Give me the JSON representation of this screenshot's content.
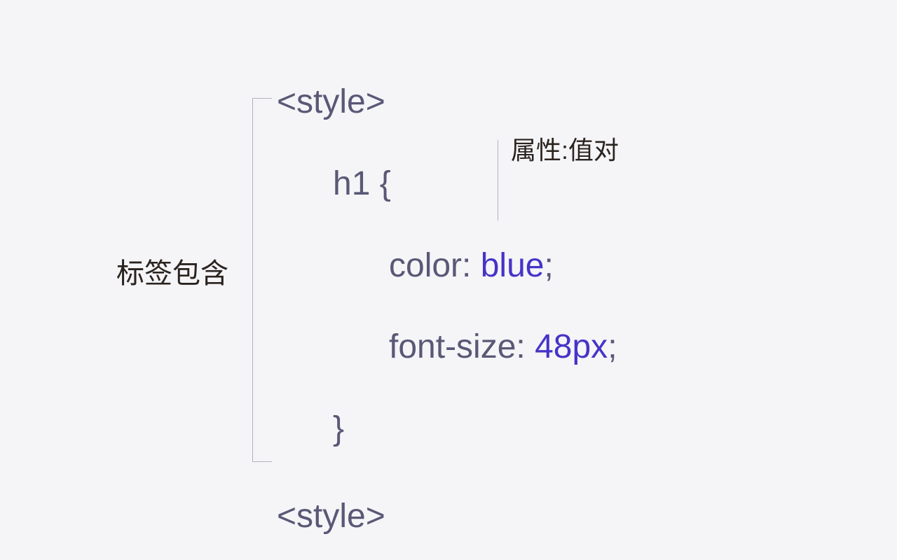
{
  "labels": {
    "tag_contains": "标签包含",
    "property_value_pair": "属性:值对"
  },
  "code": {
    "open_tag": "<style>",
    "selector": "h1 {",
    "decl1_prop": "color:",
    "decl1_value": "blue",
    "decl1_semicolon": ";",
    "decl2_prop": "font-size:",
    "decl2_value": "48px",
    "decl2_semicolon": ";",
    "close_brace": "}",
    "close_tag": "<style>"
  }
}
